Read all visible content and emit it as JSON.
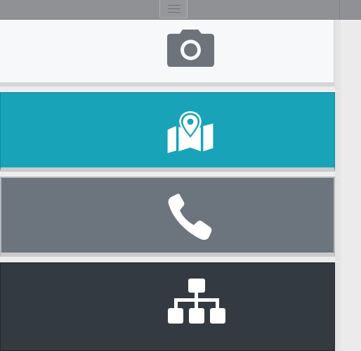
{
  "topbar": {
    "menu_icon": "hamburger-menu-icon"
  },
  "tiles": [
    {
      "name": "camera",
      "icon": "camera-icon",
      "color": "#f7f8f9",
      "icon_color": "#6c737b"
    },
    {
      "name": "maps",
      "icon": "map-marker-icon",
      "color": "#18a3b8",
      "icon_color": "#ffffff"
    },
    {
      "name": "phone",
      "icon": "phone-icon",
      "color": "#6c747d",
      "icon_color": "#ffffff"
    },
    {
      "name": "sitemap",
      "icon": "sitemap-icon",
      "color": "#343a41",
      "icon_color": "#ffffff"
    }
  ]
}
